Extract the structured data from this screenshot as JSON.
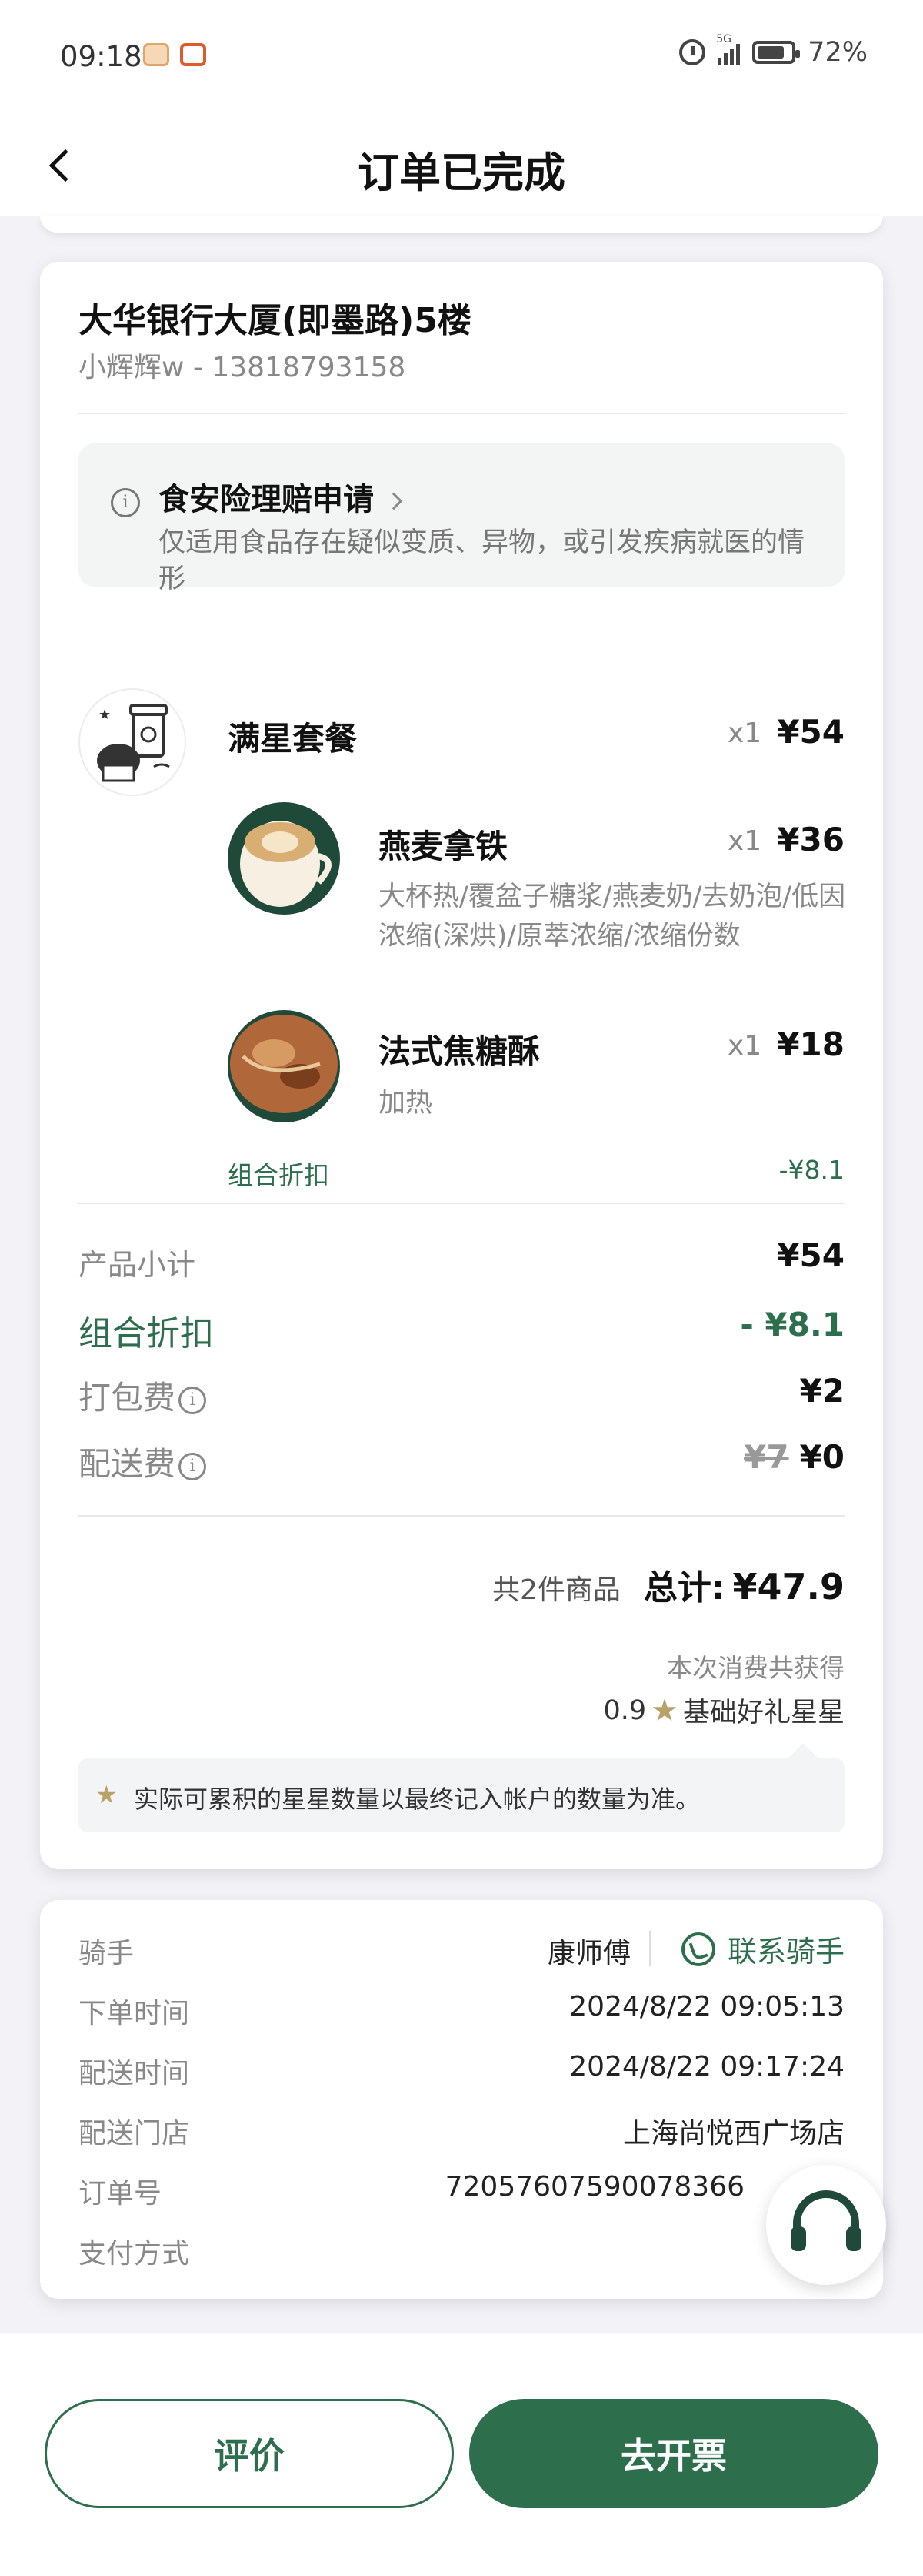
{
  "status_bar": {
    "time": "09:18",
    "net": "5G",
    "battery": "72%"
  },
  "nav": {
    "title": "订单已完成"
  },
  "address": {
    "line": "大华银行大厦(即墨路)5楼",
    "contact": "小辉辉w - 13818793158"
  },
  "insurance": {
    "title": "食安险理赔申请",
    "desc": "仅适用食品存在疑似变质、异物，或引发疾病就医的情形"
  },
  "items": {
    "set": {
      "name": "满星套餐",
      "qty": "x1",
      "price": "¥54"
    },
    "latte": {
      "name": "燕麦拿铁",
      "qty": "x1",
      "price": "¥36",
      "opts": "大杯热/覆盆子糖浆/燕麦奶/去奶泡/低因浓缩(深烘)/原萃浓缩/浓缩份数"
    },
    "pastry": {
      "name": "法式焦糖酥",
      "qty": "x1",
      "price": "¥18",
      "opts": "加热"
    },
    "combo": {
      "label": "组合折扣",
      "value": "-¥8.1"
    }
  },
  "summary": {
    "subtotal_label": "产品小计",
    "subtotal": "¥54",
    "discount_label": "组合折扣",
    "discount": "- ¥8.1",
    "packing_label": "打包费",
    "packing": "¥2",
    "delivery_label": "配送费",
    "delivery_original": "¥7",
    "delivery": "¥0",
    "count_text": "共2件商品",
    "total_label": "总计:",
    "total": "¥47.9",
    "earn_label": "本次消费共获得",
    "stars_value": "0.9",
    "stars_label": "基础好礼星星",
    "note": "实际可累积的星星数量以最终记入帐户的数量为准。"
  },
  "order_info": {
    "rider_label": "骑手",
    "rider_name": "康师傅",
    "contact_rider": "联系骑手",
    "order_time_label": "下单时间",
    "order_time": "2024/8/22 09:05:13",
    "delivery_time_label": "配送时间",
    "delivery_time": "2024/8/22 09:17:24",
    "store_label": "配送门店",
    "store": "上海尚悦西广场店",
    "order_no_label": "订单号",
    "order_no": "72057607590078366",
    "payment_label": "支付方式"
  },
  "buttons": {
    "review": "评价",
    "invoice": "去开票"
  },
  "colors": {
    "brand_green": "#2d6e4d",
    "star_gold": "#b8a267"
  }
}
